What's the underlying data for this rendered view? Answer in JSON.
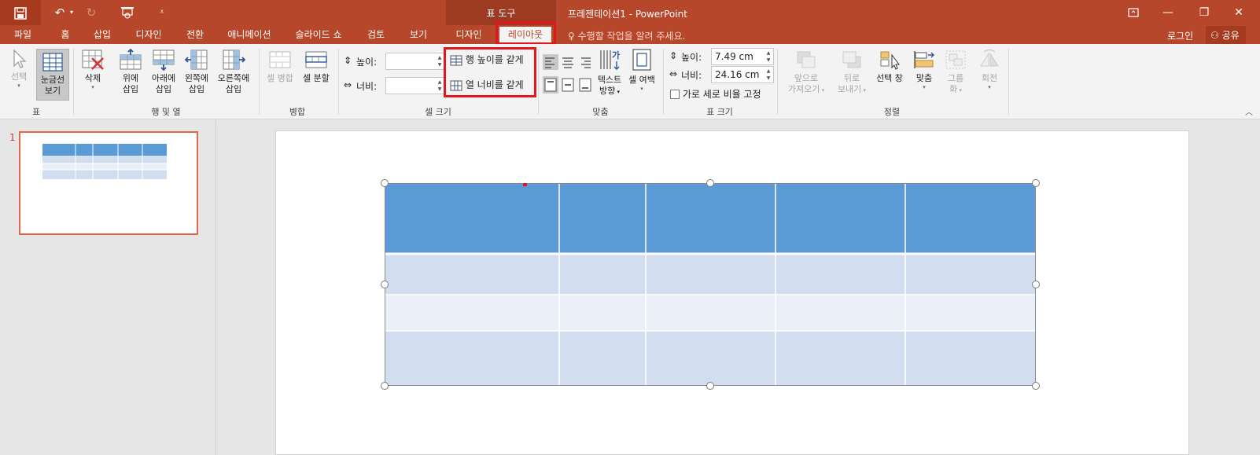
{
  "window": {
    "title": "프레젠테이션1 - PowerPoint",
    "context_group": "표 도구"
  },
  "tabs": [
    {
      "label": "파일"
    },
    {
      "label": "홈"
    },
    {
      "label": "삽입"
    },
    {
      "label": "디자인"
    },
    {
      "label": "전환"
    },
    {
      "label": "애니메이션"
    },
    {
      "label": "슬라이드 쇼"
    },
    {
      "label": "검토"
    },
    {
      "label": "보기"
    },
    {
      "label": "디자인"
    },
    {
      "label": "레이아웃",
      "active": true
    }
  ],
  "tell_me": "수행할 작업을 알려 주세요.",
  "login": "로그인",
  "share": "공유",
  "ribbon": {
    "table_group": {
      "label": "표",
      "select": "선택",
      "gridlines": [
        "눈금선",
        "보기"
      ]
    },
    "rows_cols_group": {
      "label": "행 및 열",
      "delete": "삭제",
      "insert_above": [
        "위에",
        "삽입"
      ],
      "insert_below": [
        "아래에",
        "삽입"
      ],
      "insert_left": [
        "왼쪽에",
        "삽입"
      ],
      "insert_right": [
        "오른쪽에",
        "삽입"
      ]
    },
    "merge_group": {
      "label": "병합",
      "merge_cells": "셀 병합",
      "split_cells": "셀 분할"
    },
    "cell_size_group": {
      "label": "셀 크기",
      "height_label": "높이:",
      "width_label": "너비:",
      "height_value": "",
      "width_value": "",
      "distribute_rows": "행 높이를 같게",
      "distribute_cols": "열 너비를 같게"
    },
    "alignment_group": {
      "label": "맞춤",
      "text_direction": [
        "텍스트",
        "방향"
      ],
      "cell_margins": [
        "셀 여백"
      ]
    },
    "table_size_group": {
      "label": "표 크기",
      "height_label": "높이:",
      "width_label": "너비:",
      "height_value": "7.49 cm",
      "width_value": "24.16 cm",
      "lock_aspect": "가로 세로 비율 고정"
    },
    "arrange_group": {
      "label": "정렬",
      "bring_forward": [
        "앞으로",
        "가져오기"
      ],
      "send_backward": [
        "뒤로",
        "보내기"
      ],
      "selection_pane": [
        "선택 창"
      ],
      "align": [
        "맞춤"
      ],
      "group": [
        "그룹",
        "화"
      ],
      "rotate": [
        "회전"
      ]
    }
  },
  "slides": [
    {
      "number": "1"
    }
  ],
  "table": {
    "rows": 4,
    "cols": 5,
    "header_color": "#5b9bd5",
    "band_dark": "#d2deef",
    "band_light": "#eaeff7"
  }
}
